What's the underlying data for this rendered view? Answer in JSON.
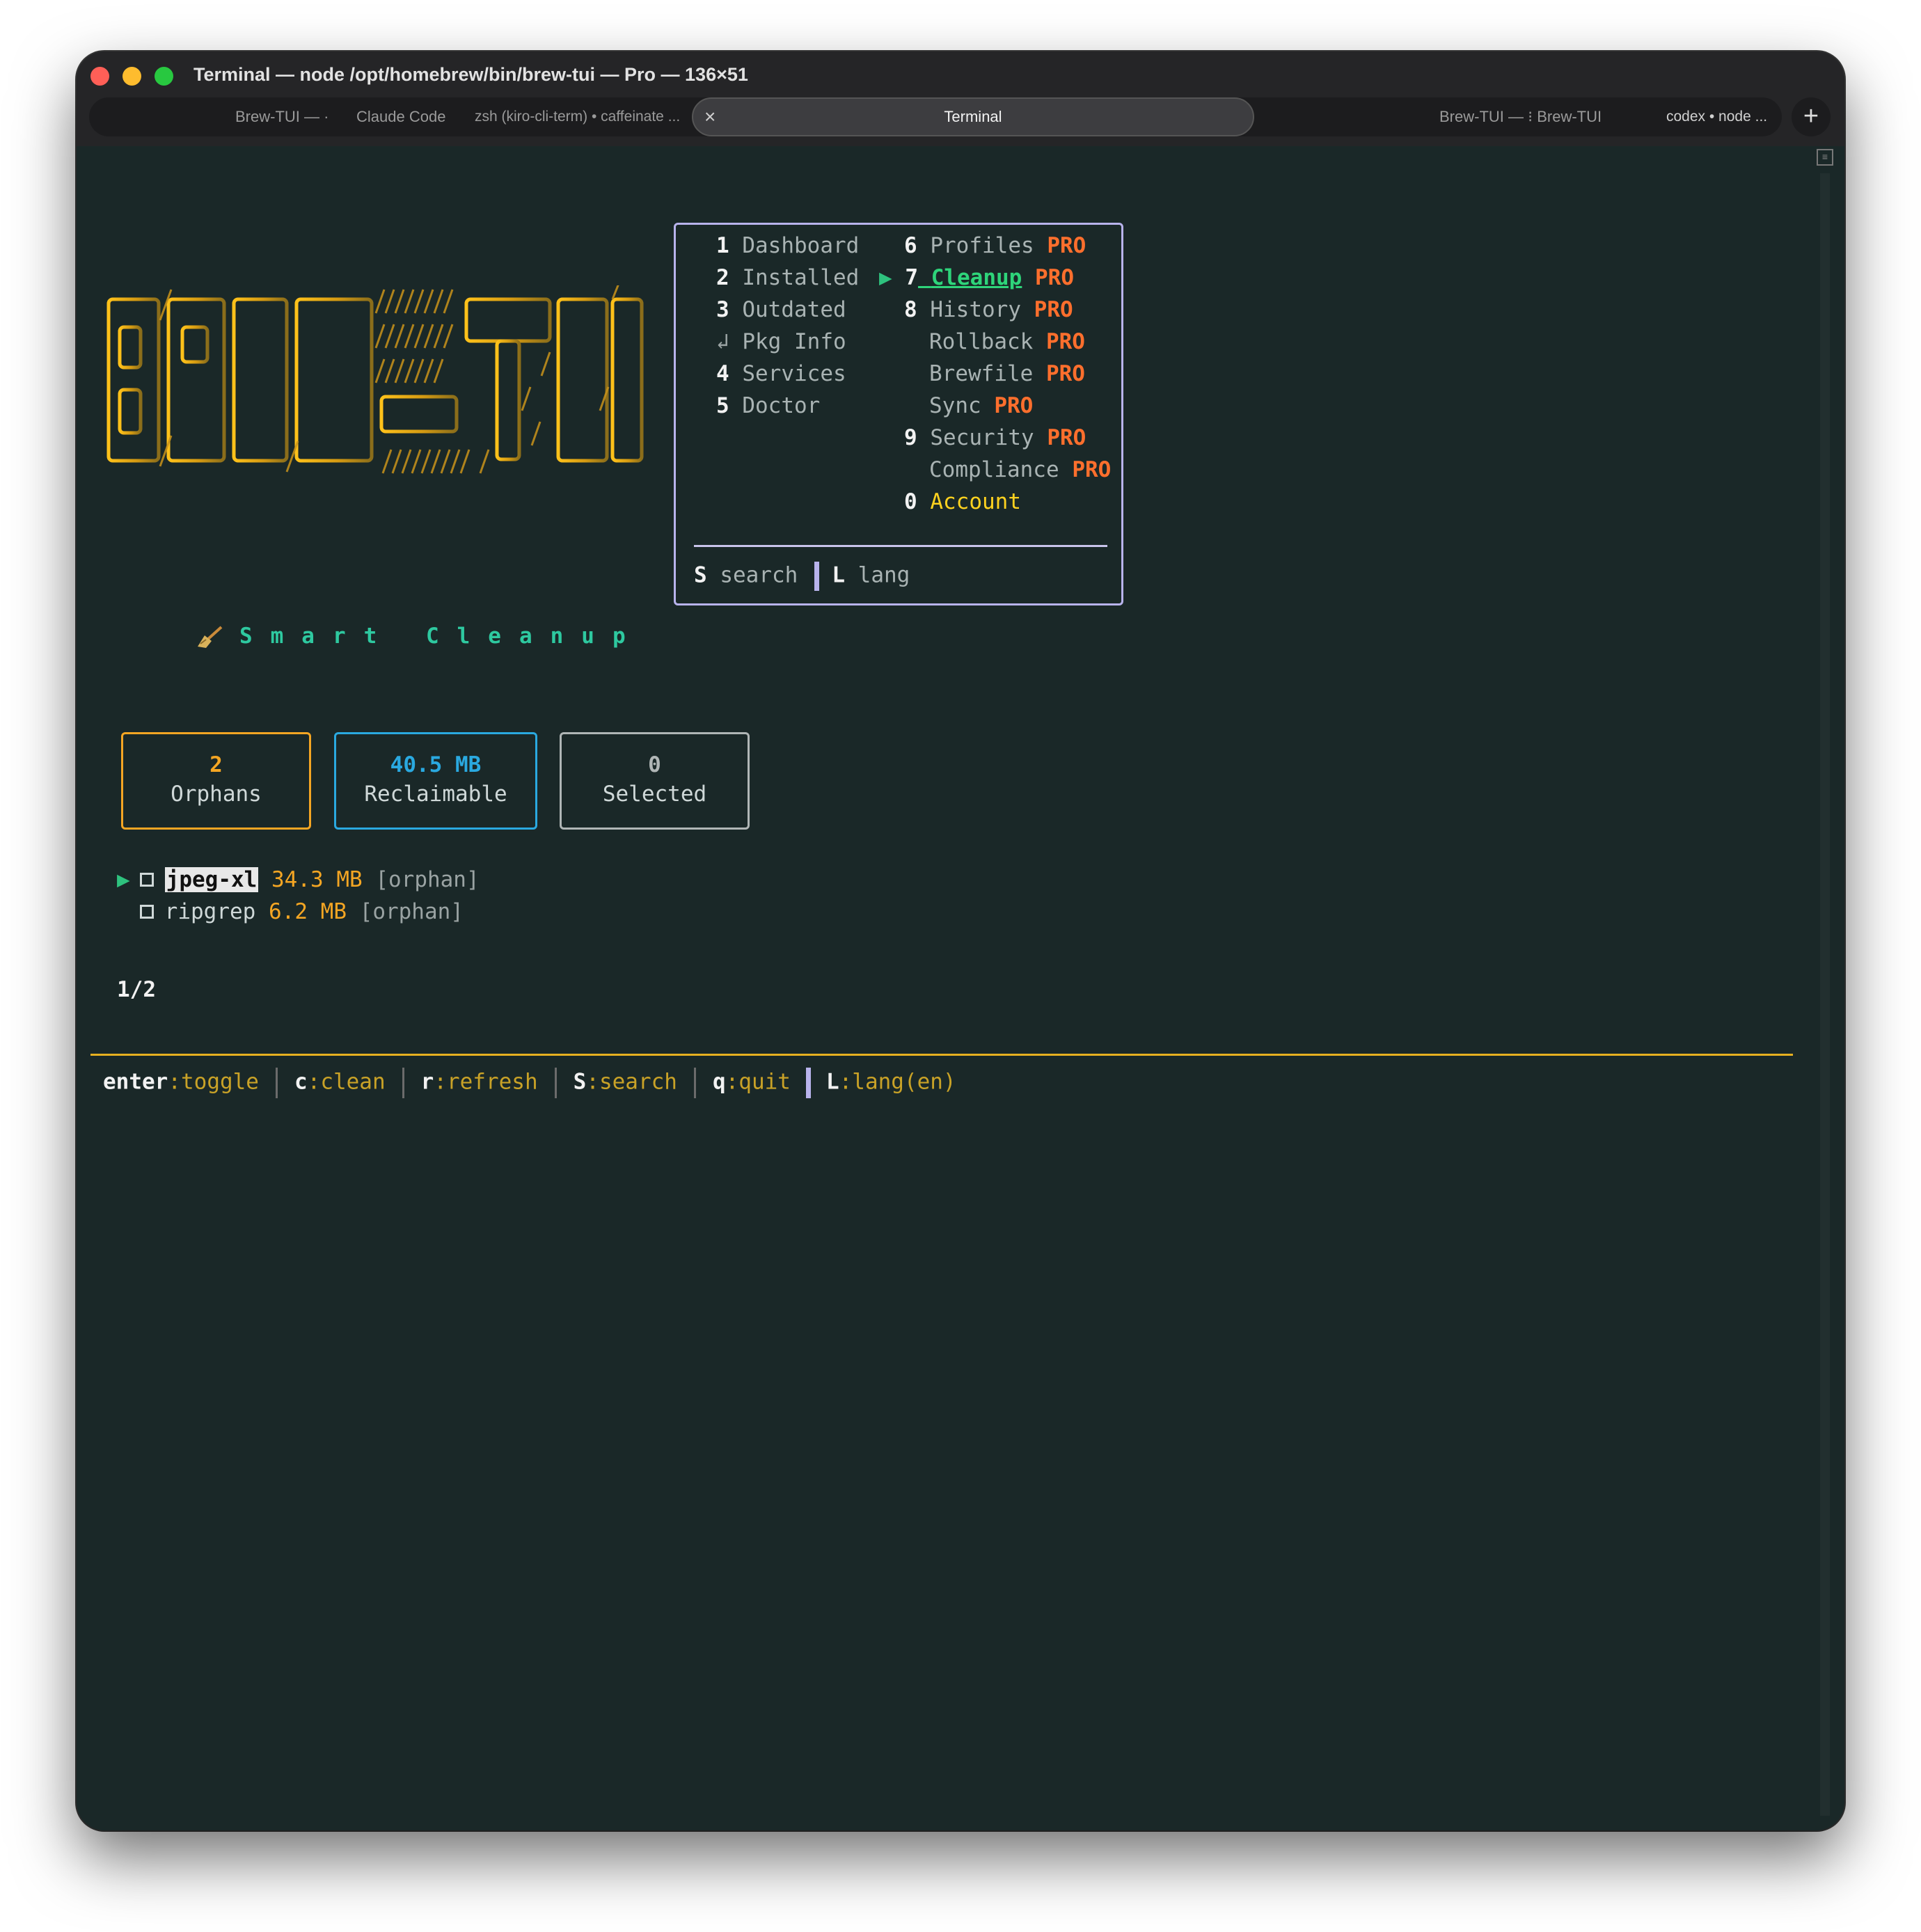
{
  "window": {
    "title": "Terminal — node /opt/homebrew/bin/brew-tui — Pro — 136×51"
  },
  "tabs": [
    {
      "label": "Brew-TUI — ·"
    },
    {
      "label": "Claude Code"
    },
    {
      "label": "zsh (kiro-cli-term) • caffeinate ..."
    },
    {
      "label": "Terminal",
      "active": true
    },
    {
      "label": "Brew-TUI — ⁝ Brew-TUI"
    },
    {
      "label": "codex • node ..."
    }
  ],
  "logo": {
    "text": "BREW-TUI"
  },
  "menu": {
    "left": [
      {
        "num": "1",
        "label": "Dashboard"
      },
      {
        "num": "2",
        "label": "Installed"
      },
      {
        "num": "3",
        "label": "Outdated"
      },
      {
        "num": "↲",
        "label": "Pkg Info"
      },
      {
        "num": "4",
        "label": "Services"
      },
      {
        "num": "5",
        "label": "Doctor"
      }
    ],
    "right": [
      {
        "num": "6",
        "label": "Profiles",
        "badge": "PRO"
      },
      {
        "num": "7",
        "label": "Cleanup",
        "badge": "PRO",
        "active": true
      },
      {
        "num": "8",
        "label": "History",
        "badge": "PRO"
      },
      {
        "num": "",
        "label": "Rollback",
        "badge": "PRO"
      },
      {
        "num": "",
        "label": "Brewfile",
        "badge": "PRO"
      },
      {
        "num": "",
        "label": "Sync",
        "badge": "PRO"
      },
      {
        "num": "9",
        "label": "Security",
        "badge": "PRO"
      },
      {
        "num": "",
        "label": "Compliance",
        "badge": "PRO"
      },
      {
        "num": "0",
        "label": "Account"
      }
    ],
    "active_marker": "▶",
    "footer": {
      "search_key": "S",
      "search_label": "search",
      "lang_key": "L",
      "lang_label": "lang"
    }
  },
  "section": {
    "icon": "broom-icon",
    "title": "Smart Cleanup"
  },
  "stats": [
    {
      "value": "2",
      "label": "Orphans",
      "color": "#f5a623"
    },
    {
      "value": "40.5 MB",
      "label": "Reclaimable",
      "color": "#2aa9e0"
    },
    {
      "value": "0",
      "label": "Selected",
      "color": "#b0b6b6"
    }
  ],
  "packages": [
    {
      "name": "jpeg-xl",
      "size": "34.3 MB",
      "tag": "[orphan]",
      "cursor": true
    },
    {
      "name": "ripgrep",
      "size": "6.2 MB",
      "tag": "[orphan]",
      "cursor": false
    }
  ],
  "pager": "1/2",
  "footer_keys": [
    {
      "key": "enter",
      "action": ":toggle"
    },
    {
      "key": "c",
      "action": ":clean"
    },
    {
      "key": "r",
      "action": ":refresh"
    },
    {
      "key": "S",
      "action": ":search"
    },
    {
      "key": "q",
      "action": ":quit"
    },
    {
      "key": "L",
      "action": ":lang(en)"
    }
  ],
  "colors": {
    "accent_green": "#2ed47a",
    "pro_orange": "#ff6f2d",
    "gold": "#e6b020",
    "menu_border": "#b8b3ec"
  }
}
